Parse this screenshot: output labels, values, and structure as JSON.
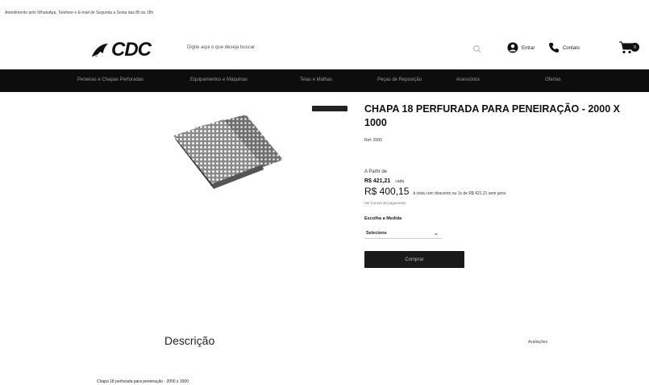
{
  "topbar": {
    "notice": "Atendimento pelo WhatsApp, Telefone e E-mail de Segunda a Sexta das 8h às 18h"
  },
  "header": {
    "logo_text": "CDC",
    "search_placeholder": "Digite aqui o que deseja buscar",
    "entrar_label": "Entrar",
    "contato_label": "Contato",
    "cart_count": "0"
  },
  "nav": {
    "items": [
      "Peneiras e Chapas Perfuradas",
      "Equipamentos e Máquinas",
      "Telas e Malhas",
      "Peças de Reposição",
      "Acessórios",
      "Ofertas"
    ]
  },
  "product": {
    "tag": "",
    "title": "CHAPA 18 PERFURADA PARA PENEIRAÇÃO - 2000 X 1000",
    "ref": "Ref: 2000",
    "price_label": "A Partir de",
    "old_price": "R$ 421,21",
    "old_price_unit": "cada",
    "new_price": "R$ 400,15",
    "new_price_info": "à vista com desconto ou 1x de R$ 421,21 sem juros",
    "sub_info": "Ver formas de pagamento",
    "size_label": "Escolha a Medida",
    "size_selected": "Selecione",
    "buy_label": "Comprar"
  },
  "description": {
    "heading": "Descrição",
    "link": "Avaliações",
    "text": "Chapa 18 perfurada para peneiração - 2000 x 1000"
  },
  "colors": {
    "nav_bg": "#0d0d0d",
    "accent": "#111111"
  }
}
